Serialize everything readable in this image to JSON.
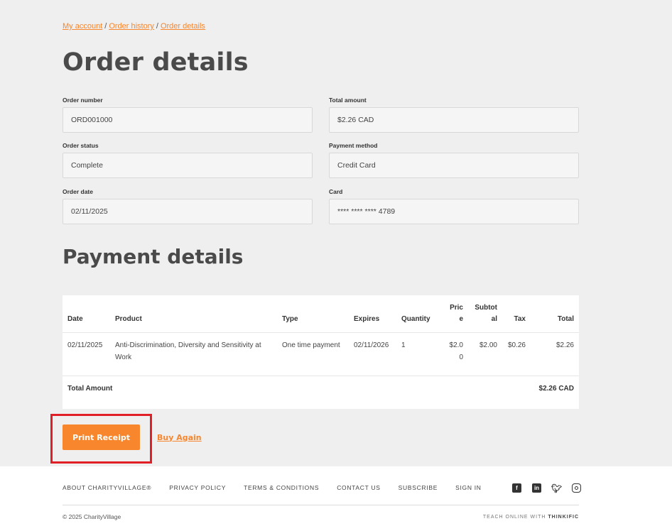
{
  "breadcrumb": {
    "items": [
      "My account",
      "Order history",
      "Order details"
    ],
    "separator": "/"
  },
  "page_title": "Order details",
  "fields": {
    "order_number": {
      "label": "Order number",
      "value": "ORD001000"
    },
    "total_amount": {
      "label": "Total amount",
      "value": "$2.26 CAD"
    },
    "order_status": {
      "label": "Order status",
      "value": "Complete"
    },
    "payment_method": {
      "label": "Payment method",
      "value": "Credit Card"
    },
    "order_date": {
      "label": "Order date",
      "value": "02/11/2025"
    },
    "card": {
      "label": "Card",
      "value": "**** **** **** 4789"
    }
  },
  "payment_section_title": "Payment details",
  "table": {
    "headers": [
      "Date",
      "Product",
      "Type",
      "Expires",
      "Quantity",
      "Price",
      "Subtotal",
      "Tax",
      "Total"
    ],
    "rows": [
      {
        "date": "02/11/2025",
        "product": "Anti-Discrimination, Diversity and Sensitivity at Work",
        "type": "One time payment",
        "expires": "02/11/2026",
        "quantity": "1",
        "price": "$2.00",
        "subtotal": "$2.00",
        "tax": "$0.26",
        "total": "$2.26"
      }
    ],
    "total_label": "Total Amount",
    "total_value": "$2.26 CAD"
  },
  "actions": {
    "print_label": "Print Receipt",
    "buy_again_label": "Buy Again"
  },
  "footer": {
    "nav": [
      "ABOUT CHARITYVILLAGE®",
      "PRIVACY POLICY",
      "TERMS & CONDITIONS",
      "CONTACT US",
      "SUBSCRIBE",
      "SIGN IN"
    ],
    "social_icons": [
      "facebook-icon",
      "linkedin-icon",
      "twitter-icon",
      "instagram-icon"
    ],
    "copyright": "© 2025 CharityVillage",
    "teach_prefix": "TEACH ONLINE WITH",
    "teach_brand": "THINKIFIC"
  },
  "colors": {
    "accent": "#f7862d",
    "highlight": "#e02026",
    "background": "#efefef"
  }
}
